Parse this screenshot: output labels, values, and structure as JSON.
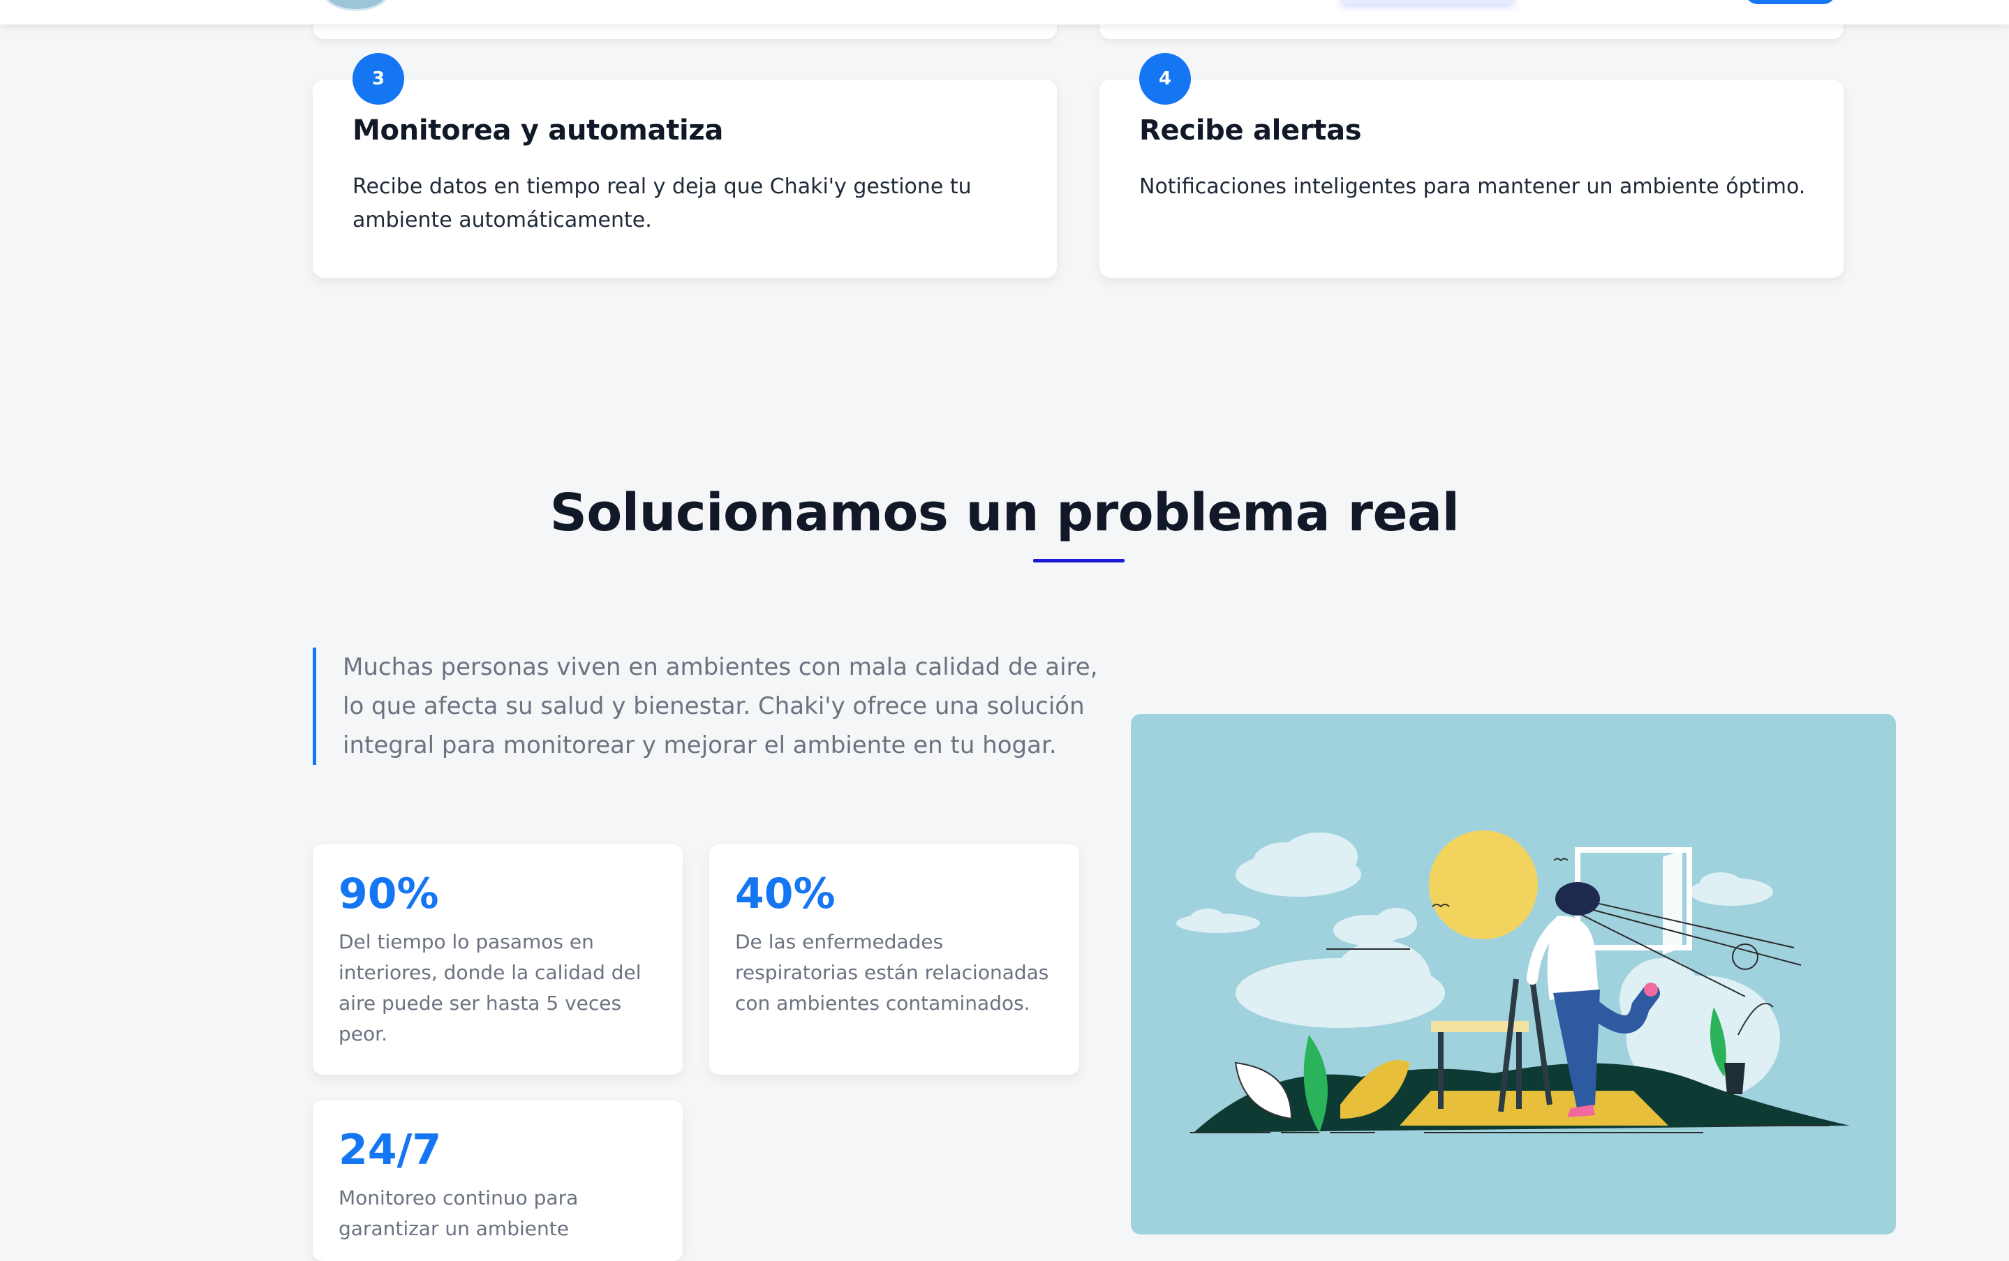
{
  "steps": [
    {
      "number": "3",
      "title": "Monitorea y automatiza",
      "description": "Recibe datos en tiempo real y deja que Chaki'y gestione tu ambiente automáticamente."
    },
    {
      "number": "4",
      "title": "Recibe alertas",
      "description": "Notificaciones inteligentes para mantener un ambiente óptimo."
    }
  ],
  "problem": {
    "title": "Solucionamos un problema real",
    "intro": "Muchas personas viven en ambientes con mala calidad de aire, lo que afecta su salud y bienestar. Chaki'y ofrece una solución integral para monitorear y mejorar el ambiente en tu hogar.",
    "stats": [
      {
        "value": "90%",
        "description": "Del tiempo lo pasamos en interiores, donde la calidad del aire puede ser hasta 5 veces peor."
      },
      {
        "value": "40%",
        "description": "De las enfermedades respiratorias están relacionadas con ambientes contaminados."
      },
      {
        "value": "24/7",
        "description": "Monitoreo continuo para garantizar un ambiente"
      }
    ]
  },
  "colors": {
    "accent": "#1476f2",
    "underline": "#1a1ad6",
    "illustration_bg": "#a0d2de",
    "sun": "#f2d35e",
    "mat": "#e8bf3a",
    "hill": "#0d3a33"
  }
}
